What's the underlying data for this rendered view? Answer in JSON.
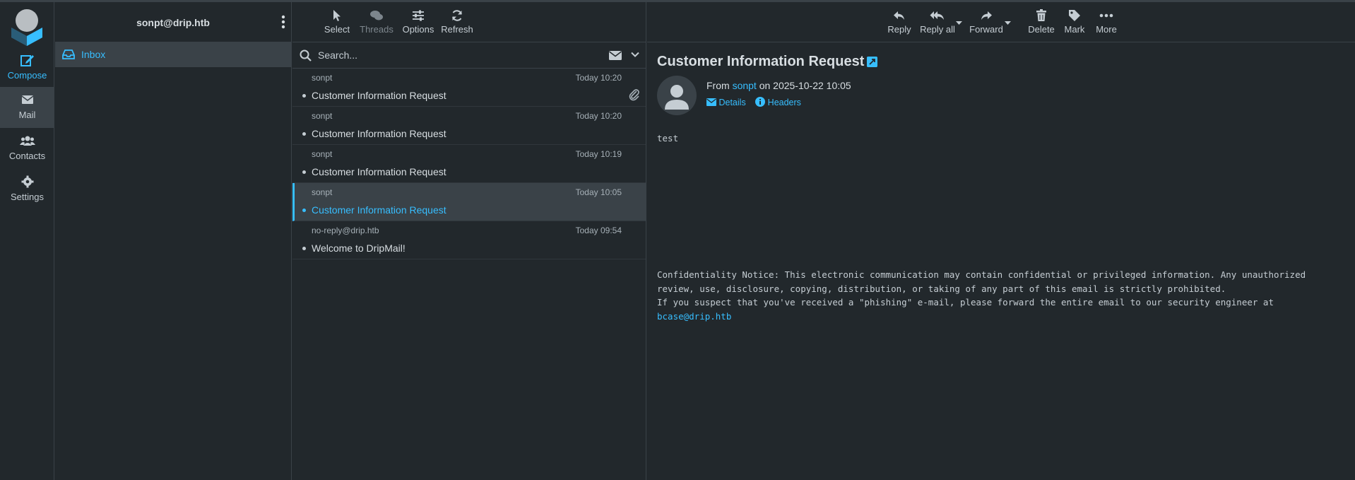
{
  "account": "sonpt@drip.htb",
  "nav": {
    "compose": "Compose",
    "mail": "Mail",
    "contacts": "Contacts",
    "settings": "Settings"
  },
  "folders": [
    {
      "label": "Inbox"
    }
  ],
  "list_toolbar": {
    "select": "Select",
    "threads": "Threads",
    "options": "Options",
    "refresh": "Refresh"
  },
  "search": {
    "placeholder": "Search..."
  },
  "messages": [
    {
      "from": "sonpt",
      "date": "Today 10:20",
      "subject": "Customer Information Request",
      "attachment": true,
      "selected": false
    },
    {
      "from": "sonpt",
      "date": "Today 10:20",
      "subject": "Customer Information Request",
      "attachment": false,
      "selected": false
    },
    {
      "from": "sonpt",
      "date": "Today 10:19",
      "subject": "Customer Information Request",
      "attachment": false,
      "selected": false
    },
    {
      "from": "sonpt",
      "date": "Today 10:05",
      "subject": "Customer Information Request",
      "attachment": false,
      "selected": true
    },
    {
      "from": "no-reply@drip.htb",
      "date": "Today 09:54",
      "subject": "Welcome to DripMail!",
      "attachment": false,
      "selected": false
    }
  ],
  "preview_toolbar": {
    "reply": "Reply",
    "reply_all": "Reply all",
    "forward": "Forward",
    "delete": "Delete",
    "mark": "Mark",
    "more": "More"
  },
  "preview": {
    "subject": "Customer Information Request",
    "from_prefix": "From",
    "sender": "sonpt",
    "on_date": "on 2025-10-22 10:05",
    "details": "Details",
    "headers": "Headers",
    "body": "test",
    "notice_line1": "Confidentiality Notice: This electronic communication may contain confidential or privileged information. Any unauthorized",
    "notice_line2": "review, use, disclosure, copying, distribution, or taking of any part of this email is strictly prohibited.",
    "notice_line3": "If you suspect that you've received a \"phishing\" e-mail, please forward the entire email to our security engineer at",
    "notice_email": "bcase@drip.htb"
  },
  "colors": {
    "accent": "#37beff",
    "background": "#22282c",
    "selected": "#3a4248"
  }
}
